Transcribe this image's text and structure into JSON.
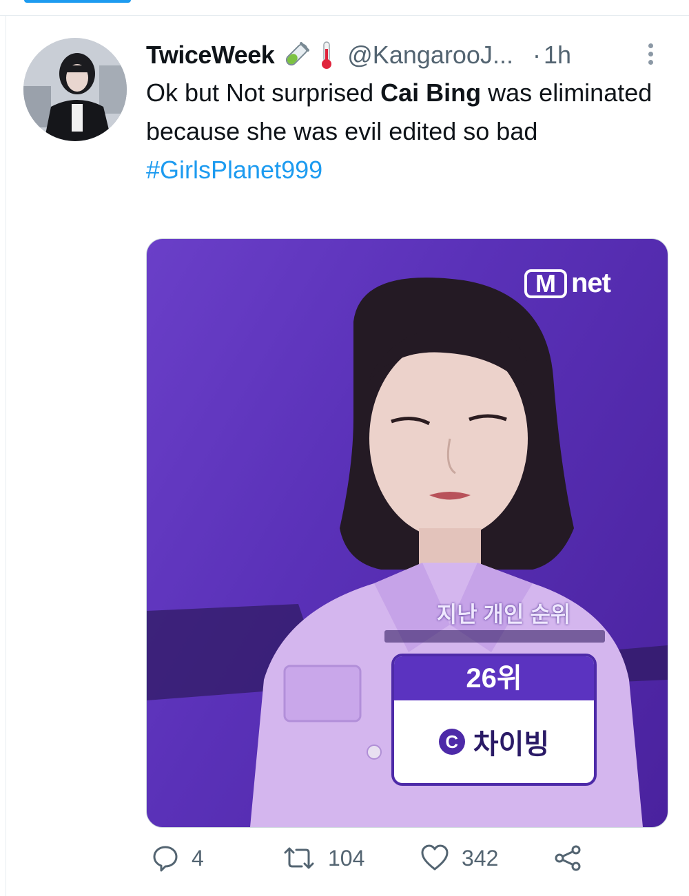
{
  "tweet": {
    "display_name": "TwiceWeek",
    "name_emojis": [
      "test-tube-icon",
      "thermometer-icon"
    ],
    "handle": "@KangarooJ...",
    "separator": "·",
    "time": "1h",
    "text_1": "Ok but Not surprised ",
    "text_bold": "Cai Bing",
    "text_2": " was eliminated because she was evil edited so bad",
    "hashtag": "#GirlsPlanet999"
  },
  "media": {
    "logo_m": "M",
    "logo_text": "net",
    "rank_caption": "지난 개인 순위",
    "rank": "26위",
    "group_badge": "C",
    "contestant_name": "차이빙"
  },
  "actions": {
    "replies": "4",
    "retweets": "104",
    "likes": "342"
  },
  "colors": {
    "accent": "#1d9bf0",
    "secondary_text": "#536471",
    "media_purple": "#5a31b8"
  }
}
